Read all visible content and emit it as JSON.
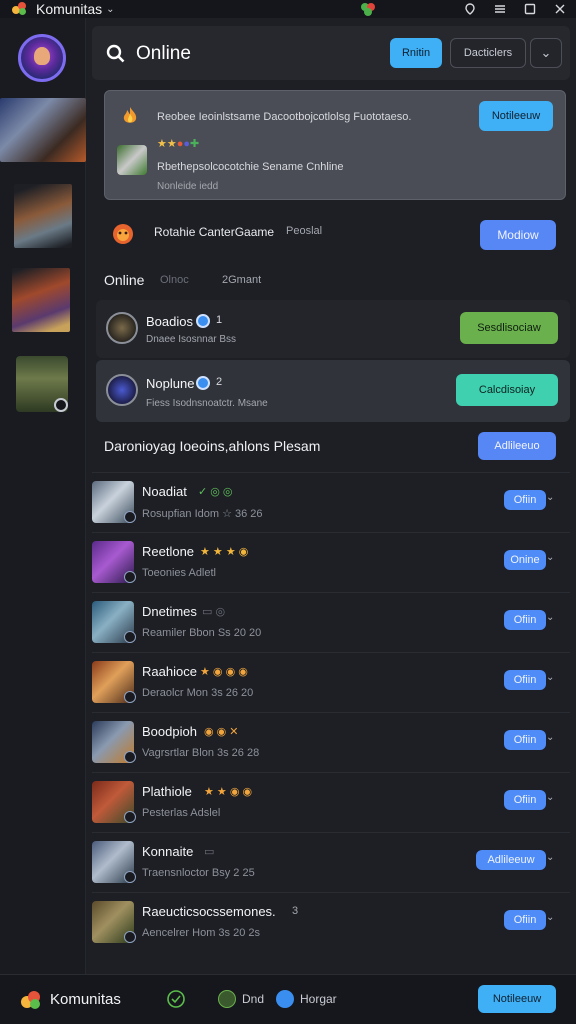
{
  "app": {
    "title": "Komunitas"
  },
  "header": {
    "title": "Online",
    "primary_button": "Rnitin",
    "secondary_button": "Dacticlers"
  },
  "featured": {
    "line1": "Reobee Ieoinlstsame Dacootbojcotlolsg Fuototaeso.",
    "action": "Notileeuw",
    "line2": "Rbethepsolcocotchie Sename Cnhline",
    "line3": "Nonleide iedd"
  },
  "game_row": {
    "label": "Rotahie CanterGaame",
    "tag": "Peoslal",
    "action": "Modiow"
  },
  "online_section": {
    "label": "Online",
    "meta1": "Olnoc",
    "meta2": "2Gmant"
  },
  "friends": [
    {
      "name": "Boadios",
      "count": "1",
      "sub": "Dnaee Isosnnar Bss",
      "action": "Sesdlisociaw"
    },
    {
      "name": "Noplune",
      "count": "2",
      "sub": "Fiess Isodnsnoatctr. Msane",
      "action": "Calcdisoiay"
    }
  ],
  "list_header": {
    "title": "Daronioyag Ioeoins,ahlons Plesam",
    "action": "Adlileeuo"
  },
  "list": [
    {
      "name": "Noadiat",
      "marks": "✓ ◎ ◎",
      "sub": "Rosupfian Idom ☆ 36 26",
      "action": "Ofiin"
    },
    {
      "name": "Reetlone",
      "marks": "★ ★ ★ ◉",
      "sub": "Toeonies Adletl",
      "action": "Onine"
    },
    {
      "name": "Dnetimes",
      "marks": "▭ ◎",
      "sub": "Reamiler Bbon Ss 20 20",
      "action": "Ofiin"
    },
    {
      "name": "Raahioce",
      "marks": "★ ◉ ◉ ◉",
      "sub": "Deraolcr Mon 3s 26 20",
      "action": "Ofiin"
    },
    {
      "name": "Boodpioh",
      "marks": "◉ ◉  ✕",
      "sub": "Vagrsrtlar Blon 3s 26 28",
      "action": "Ofiin"
    },
    {
      "name": "Plathiole",
      "marks": "★ ★ ◉ ◉",
      "sub": "Pesterlas Adslel",
      "action": "Ofiin"
    },
    {
      "name": "Konnaite",
      "marks": "▭",
      "sub": "Traensnloctor Bsy 2 25",
      "action": "Adlileeuw"
    },
    {
      "name": "Raeucticsocssemones.",
      "marks": "3",
      "sub": "Aencelrer Hom 3s 20 2s",
      "action": "Ofiin"
    }
  ],
  "bottom_bar": {
    "app": "Komunitas",
    "item1": "Dnd",
    "item2": "Horgar",
    "action": "Notileeuw"
  },
  "colors": {
    "accent_blue": "#3fb0f5",
    "button_blue": "#5786f5",
    "green": "#6ab04c",
    "teal": "#3fd0b0",
    "background": "#1d1f25"
  }
}
